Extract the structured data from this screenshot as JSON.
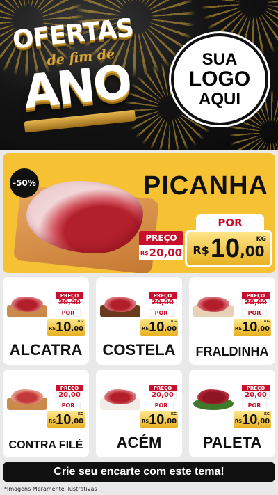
{
  "header": {
    "title_line1": "OFERTAS",
    "title_line2": "de fim de",
    "title_line3": "ANO",
    "logo_line1": "SUA",
    "logo_line2": "LOGO",
    "logo_line3": "AQUI"
  },
  "hero": {
    "discount": "-50%",
    "product": "PICANHA",
    "preco_label": "PREÇO",
    "old_currency": "R$",
    "old_price": "20,00",
    "por_label": "POR",
    "currency": "R$",
    "price_int": "10",
    "price_dec": ",00",
    "unit": "KG"
  },
  "cards": [
    {
      "name": "ALCATRA",
      "preco_label": "PREÇO",
      "old_currency": "R$",
      "old_price": "20,00",
      "por_label": "POR",
      "currency": "R$",
      "price_int": "10",
      "price_dec": ",00",
      "unit": "KG"
    },
    {
      "name": "COSTELA",
      "preco_label": "PREÇO",
      "old_currency": "R$",
      "old_price": "20,00",
      "por_label": "POR",
      "currency": "R$",
      "price_int": "10",
      "price_dec": ",00",
      "unit": "KG"
    },
    {
      "name": "FRALDINHA",
      "preco_label": "PREÇO",
      "old_currency": "R$",
      "old_price": "20,00",
      "por_label": "POR",
      "currency": "R$",
      "price_int": "10",
      "price_dec": ",00",
      "unit": "KG"
    },
    {
      "name": "CONTRA FILÉ",
      "preco_label": "PREÇO",
      "old_currency": "R$",
      "old_price": "20,00",
      "por_label": "POR",
      "currency": "R$",
      "price_int": "10",
      "price_dec": ",00",
      "unit": "KG"
    },
    {
      "name": "ACÉM",
      "preco_label": "PREÇO",
      "old_currency": "R$",
      "old_price": "20,00",
      "por_label": "POR",
      "currency": "R$",
      "price_int": "10",
      "price_dec": ",00",
      "unit": "KG"
    },
    {
      "name": "PALETA",
      "preco_label": "PREÇO",
      "old_currency": "R$",
      "old_price": "20,00",
      "por_label": "POR",
      "currency": "R$",
      "price_int": "10",
      "price_dec": ",00",
      "unit": "KG"
    }
  ],
  "footer": {
    "cta": "Crie seu encarte com este tema!",
    "note": "*Imagens Meramente Ilustrativas"
  },
  "colors": {
    "accent_yellow": "#f6c233",
    "price_red": "#c8102e",
    "gold": "#d7a53a",
    "dark": "#111111"
  }
}
